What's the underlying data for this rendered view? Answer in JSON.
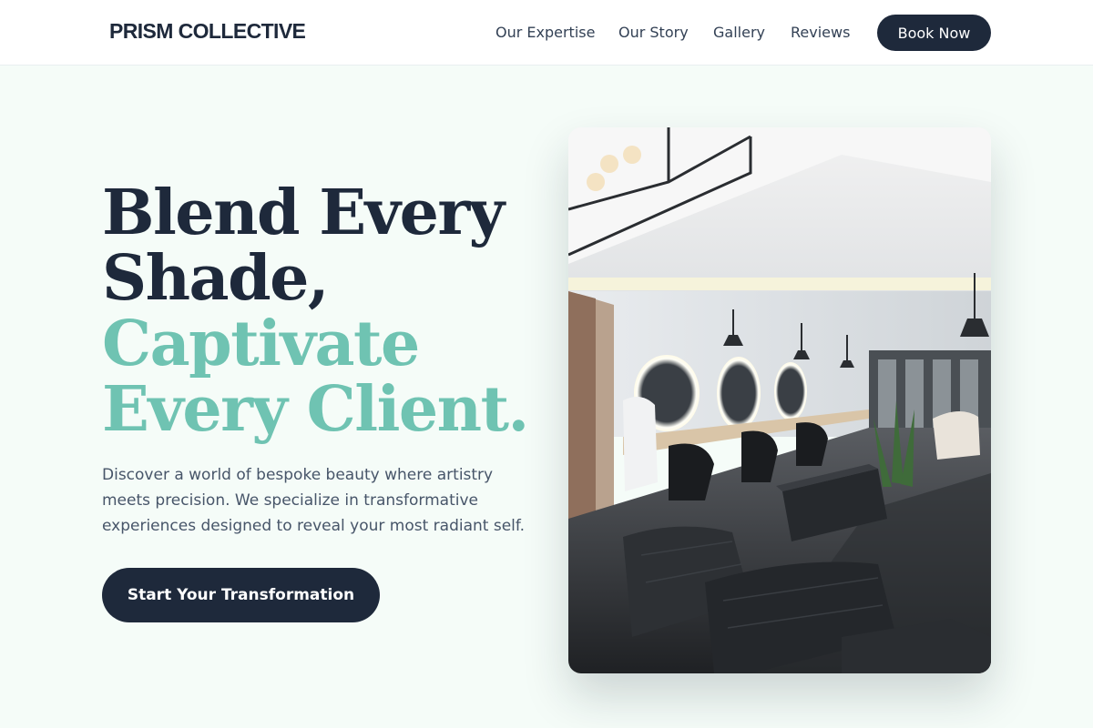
{
  "nav": {
    "brand": "PRISM COLLECTIVE",
    "links": [
      "Our Expertise",
      "Our Story",
      "Gallery",
      "Reviews"
    ],
    "book_label": "Book Now"
  },
  "hero": {
    "title_line1": "Blend Every",
    "title_line2": "Shade,",
    "title_accent1": "Captivate",
    "title_accent2": "Every Client.",
    "description": "Discover a world of bespoke beauty where artistry meets precision. We specialize in transformative experiences designed to reveal your most radiant self.",
    "cta_label": "Start Your Transformation"
  },
  "colors": {
    "primary": "#1e293b",
    "accent": "#6fc3b2",
    "background": "#f5fcf8"
  }
}
